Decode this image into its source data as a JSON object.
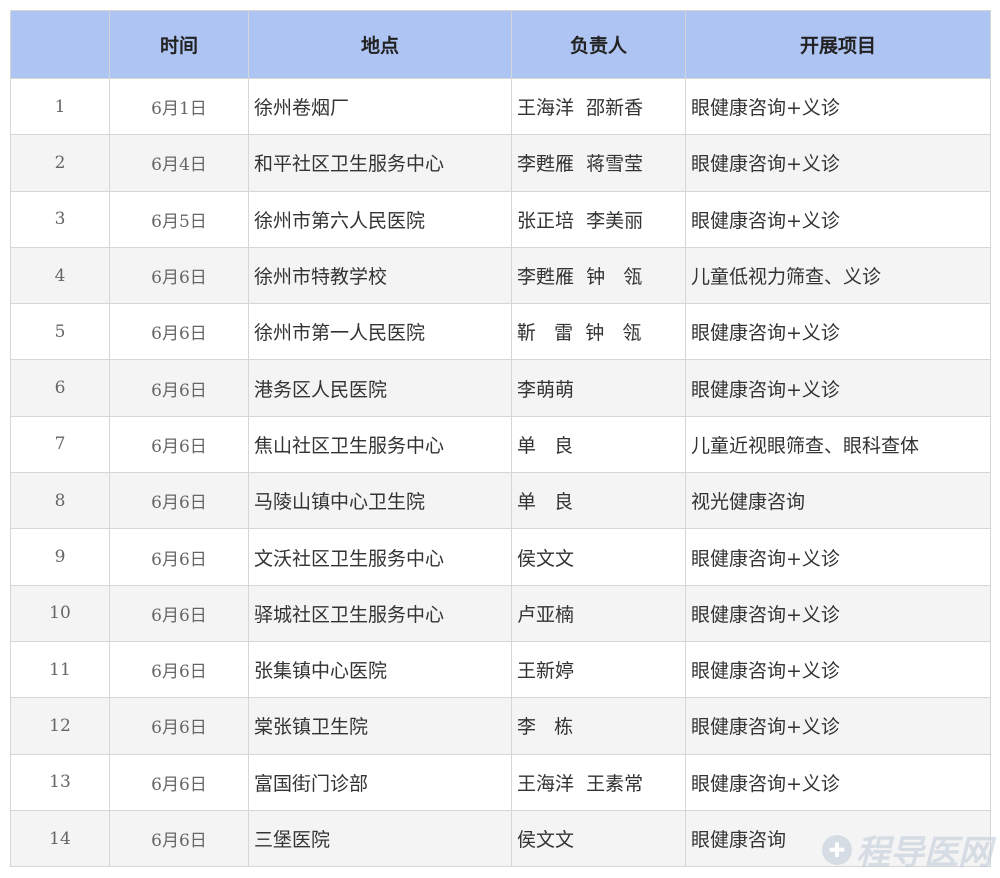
{
  "table": {
    "headers": [
      "",
      "时间",
      "地点",
      "负责人",
      "开展项目"
    ],
    "rows": [
      {
        "idx": "1",
        "time": "6月1日",
        "place": "徐州卷烟厂",
        "person": "王海洋  邵新香",
        "project": "眼健康咨询+义诊"
      },
      {
        "idx": "2",
        "time": "6月4日",
        "place": "和平社区卫生服务中心",
        "person": "李甦雁  蒋雪莹",
        "project": "眼健康咨询+义诊"
      },
      {
        "idx": "3",
        "time": "6月5日",
        "place": "徐州市第六人民医院",
        "person": "张正培  李美丽",
        "project": "眼健康咨询+义诊"
      },
      {
        "idx": "4",
        "time": "6月6日",
        "place": "徐州市特教学校",
        "person": "李甦雁  钟   瓴",
        "project": "儿童低视力筛查、义诊"
      },
      {
        "idx": "5",
        "time": "6月6日",
        "place": "徐州市第一人民医院",
        "person": "靳   雷  钟   瓴",
        "project": "眼健康咨询+义诊"
      },
      {
        "idx": "6",
        "time": "6月6日",
        "place": "港务区人民医院",
        "person": "李萌萌",
        "project": "眼健康咨询+义诊"
      },
      {
        "idx": "7",
        "time": "6月6日",
        "place": "焦山社区卫生服务中心",
        "person": "单   良",
        "project": "儿童近视眼筛查、眼科查体"
      },
      {
        "idx": "8",
        "time": "6月6日",
        "place": "马陵山镇中心卫生院",
        "person": "单   良",
        "project": "视光健康咨询"
      },
      {
        "idx": "9",
        "time": "6月6日",
        "place": "文沃社区卫生服务中心",
        "person": "侯文文",
        "project": "眼健康咨询+义诊"
      },
      {
        "idx": "10",
        "time": "6月6日",
        "place": "驿城社区卫生服务中心",
        "person": "卢亚楠",
        "project": "眼健康咨询+义诊"
      },
      {
        "idx": "11",
        "time": "6月6日",
        "place": "张集镇中心医院",
        "person": "王新婷",
        "project": "眼健康咨询+义诊"
      },
      {
        "idx": "12",
        "time": "6月6日",
        "place": "棠张镇卫生院",
        "person": "李   栋",
        "project": "眼健康咨询+义诊"
      },
      {
        "idx": "13",
        "time": "6月6日",
        "place": "富国街门诊部",
        "person": "王海洋  王素常",
        "project": "眼健康咨询+义诊"
      },
      {
        "idx": "14",
        "time": "6月6日",
        "place": "三堡医院",
        "person": "侯文文",
        "project": "眼健康咨询"
      }
    ]
  },
  "watermark": {
    "text": "程导医网",
    "icon": "watermark-logo-icon"
  },
  "colors": {
    "header_bg": "#aec4f3",
    "alt_row_bg": "#f4f4f4",
    "border": "#d6d6d6"
  }
}
